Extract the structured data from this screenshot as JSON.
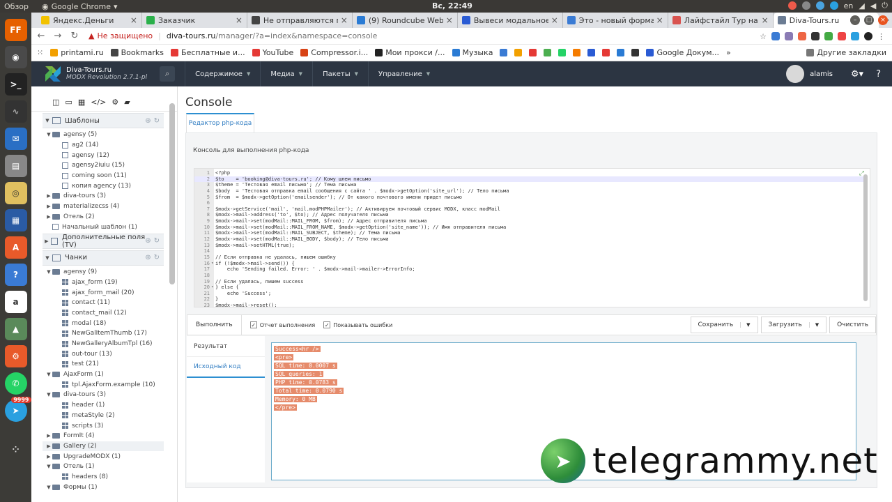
{
  "os": {
    "overview": "Обзор",
    "app": "Google Chrome",
    "clock": "Вс, 22:49",
    "lang": "en"
  },
  "dock": {
    "badge": "9999"
  },
  "tabs": [
    {
      "label": "Яндекс.Деньги",
      "color": "#f2c200"
    },
    {
      "label": "Заказчик",
      "color": "#2ab04a"
    },
    {
      "label": "Не отправляются пи",
      "color": "#444444"
    },
    {
      "label": "(9) Roundcube Webm",
      "color": "#2a7bd4"
    },
    {
      "label": "Вывеси модальное о",
      "color": "#2a5bd4"
    },
    {
      "label": "Это - новый формат",
      "color": "#3a7bd4"
    },
    {
      "label": "Лайфстайл Тур на Б",
      "color": "#d9534f"
    },
    {
      "label": "Diva-Tours.ru",
      "color": "#6b7c93"
    }
  ],
  "address": {
    "not_secure": "Не защищено",
    "host": "diva-tours.ru",
    "path": "/manager/?a=index&namespace=console"
  },
  "bookmarks": [
    "printami.ru",
    "Bookmarks",
    "Бесплатные и...",
    "YouTube",
    "Compressor.i...",
    "Мои прокси /...",
    "Музыка",
    "Google Докум..."
  ],
  "other_bookmarks": "Другие закладки",
  "modx": {
    "brand": "Diva-Tours.ru",
    "version": "MODX Revolution 2.7.1-pl",
    "nav": [
      "Содержимое",
      "Медиа",
      "Пакеты",
      "Управление"
    ],
    "user": "alamis"
  },
  "sidebar": {
    "sec_templates": "Шаблоны",
    "templates": [
      {
        "label": "agensy (5)",
        "lvl": 0,
        "type": "folder",
        "exp": true
      },
      {
        "label": "ag2 (14)",
        "lvl": 1,
        "type": "tpl"
      },
      {
        "label": "agensy (12)",
        "lvl": 1,
        "type": "tpl"
      },
      {
        "label": "agensy2iuiu (15)",
        "lvl": 1,
        "type": "tpl"
      },
      {
        "label": "coming soon (11)",
        "lvl": 1,
        "type": "tpl"
      },
      {
        "label": "копия agency (13)",
        "lvl": 1,
        "type": "tpl"
      },
      {
        "label": "diva-tours (3)",
        "lvl": 0,
        "type": "folder",
        "exp": false
      },
      {
        "label": "materializecss (4)",
        "lvl": 0,
        "type": "folder",
        "exp": false
      },
      {
        "label": "Отель (2)",
        "lvl": 0,
        "type": "folder",
        "exp": false
      },
      {
        "label": "Начальный шаблон (1)",
        "lvl": 0,
        "type": "tpl"
      }
    ],
    "sec_tv": "Дополнительные поля (TV)",
    "sec_chunks": "Чанки",
    "chunks": [
      {
        "label": "agensy (9)",
        "lvl": 0,
        "type": "folder",
        "exp": true
      },
      {
        "label": "ajax_form (19)",
        "lvl": 1,
        "type": "chunk"
      },
      {
        "label": "ajax_form_mail (20)",
        "lvl": 1,
        "type": "chunk"
      },
      {
        "label": "contact (11)",
        "lvl": 1,
        "type": "chunk"
      },
      {
        "label": "contact_mail (12)",
        "lvl": 1,
        "type": "chunk"
      },
      {
        "label": "modal (18)",
        "lvl": 1,
        "type": "chunk"
      },
      {
        "label": "NewGalItemThumb (17)",
        "lvl": 1,
        "type": "chunk"
      },
      {
        "label": "NewGalleryAlbumTpl (16)",
        "lvl": 1,
        "type": "chunk"
      },
      {
        "label": "out-tour (13)",
        "lvl": 1,
        "type": "chunk"
      },
      {
        "label": "test (21)",
        "lvl": 1,
        "type": "chunk"
      },
      {
        "label": "AjaxForm (1)",
        "lvl": 0,
        "type": "folder",
        "exp": true
      },
      {
        "label": "tpl.AjaxForm.example (10)",
        "lvl": 1,
        "type": "chunk"
      },
      {
        "label": "diva-tours (3)",
        "lvl": 0,
        "type": "folder",
        "exp": true
      },
      {
        "label": "header (1)",
        "lvl": 1,
        "type": "chunk"
      },
      {
        "label": "metaStyle (2)",
        "lvl": 1,
        "type": "chunk"
      },
      {
        "label": "scripts (3)",
        "lvl": 1,
        "type": "chunk"
      },
      {
        "label": "FormIt (4)",
        "lvl": 0,
        "type": "folder",
        "exp": false
      },
      {
        "label": "Gallery (2)",
        "lvl": 0,
        "type": "folder",
        "exp": false,
        "hl": true
      },
      {
        "label": "UpgradeMODX (1)",
        "lvl": 0,
        "type": "folder",
        "exp": false
      },
      {
        "label": "Отель (1)",
        "lvl": 0,
        "type": "folder",
        "exp": true
      },
      {
        "label": "headers (8)",
        "lvl": 1,
        "type": "chunk"
      },
      {
        "label": "Формы (1)",
        "lvl": 0,
        "type": "folder",
        "exp": true
      }
    ]
  },
  "console": {
    "title": "Console",
    "tab": "Редактор php-кода",
    "desc": "Консоль для выполнения php-кода",
    "code": [
      "<?php",
      "$to    = 'booking@diva-tours.ru'; // Кому шлем письмо",
      "$theme = 'Тестовая email письмо'; // Тема письма",
      "$body  = 'Тестовая отправка email сообщения с сайта ' . $modx->getOption('site_url'); // Тело письма",
      "$from  = $modx->getOption('emailsender'); // От какого почтового имени придет письмо",
      "",
      "$modx->getService('mail', 'mail.modPHPMailer'); // Активируем почтовый сервис MODX, класс modMail",
      "$modx->mail->address('to', $to); // Адрес получателя письма",
      "$modx->mail->set(modMail::MAIL_FROM, $from); // Адрес отправителя письма",
      "$modx->mail->set(modMail::MAIL_FROM_NAME, $modx->getOption('site_name')); // Имя отправителя письма",
      "$modx->mail->set(modMail::MAIL_SUBJECT, $theme); // Тема письма",
      "$modx->mail->set(modMail::MAIL_BODY, $body); // Тело письма",
      "$modx->mail->setHTML(true);",
      "",
      "// Если отправка не удалась, пишем ошибку",
      "if (!$modx->mail->send()) {",
      "    echo 'Sending failed. Error: ' . $modx->mail->mailer->ErrorInfo;",
      "",
      "// Если удалась, пишем success",
      "} else {",
      "    echo 'Success';",
      "}",
      "$modx->mail->reset();"
    ],
    "run": "Выполнить",
    "cb_report": "Отчет выполнения",
    "cb_errors": "Показывать ошибки",
    "save": "Сохранить",
    "load": "Загрузить",
    "clear": "Очистить",
    "rtab_result": "Результат",
    "rtab_source": "Исходный код",
    "output": [
      "Success<hr />",
      "<pre>",
      "SQL time: 0.0007 s",
      "SQL queries: 1",
      "PHP time: 0.0783 s",
      "Total time: 0.0790 s",
      "Memory: 0 MB",
      "</pre>"
    ]
  },
  "watermark": "telegrammy.net"
}
